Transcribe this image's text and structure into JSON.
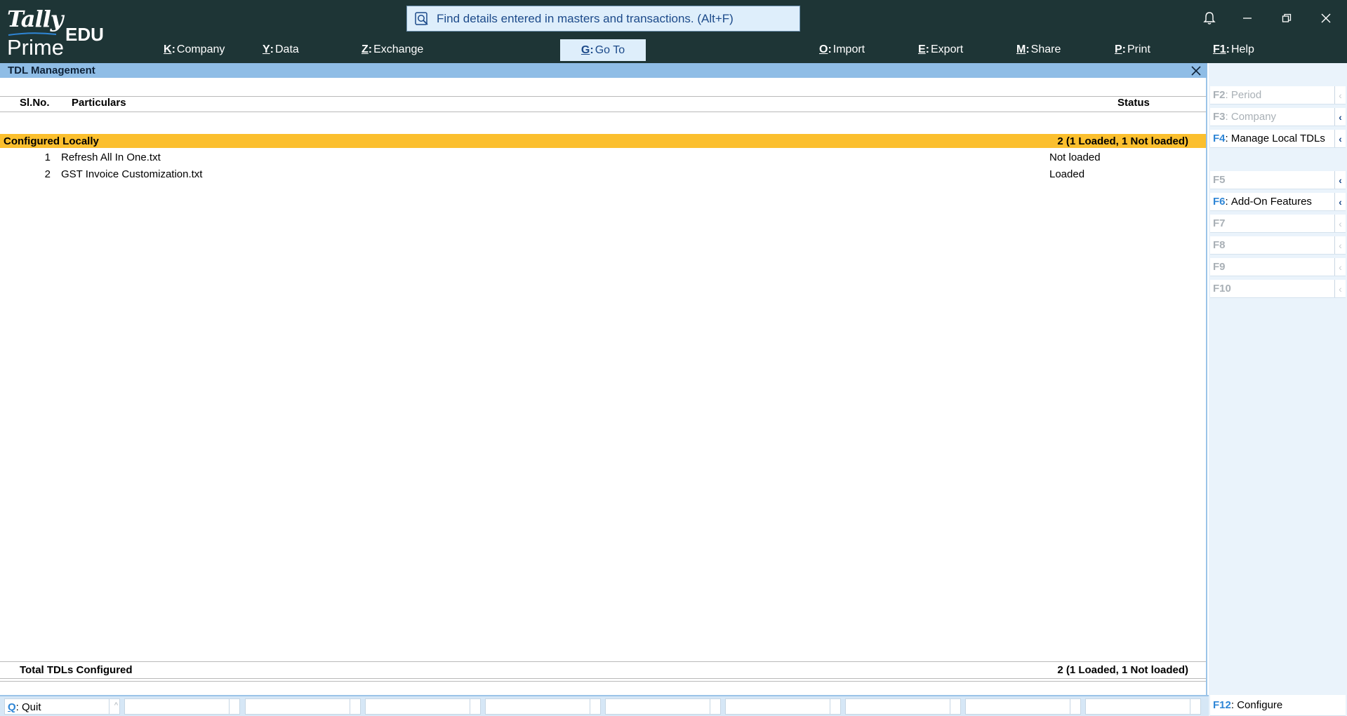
{
  "app": {
    "logo_tally": "Tally",
    "logo_prime": "Prime",
    "logo_edu": "EDU"
  },
  "search": {
    "placeholder": "Find details entered in masters and transactions. (Alt+F)"
  },
  "menu": [
    {
      "key": "K",
      "label": "Company"
    },
    {
      "key": "Y",
      "label": "Data"
    },
    {
      "key": "Z",
      "label": "Exchange"
    },
    {
      "key": "G",
      "label": "Go To"
    },
    {
      "key": "O",
      "label": "Import"
    },
    {
      "key": "E",
      "label": "Export"
    },
    {
      "key": "M",
      "label": "Share"
    },
    {
      "key": "P",
      "label": "Print"
    },
    {
      "key": "F1",
      "label": "Help"
    }
  ],
  "window_icons": [
    "bell-icon",
    "minimize-icon",
    "restore-icon",
    "close-icon"
  ],
  "screen": {
    "title": "TDL Management",
    "col_slno": "Sl.No.",
    "col_particulars": "Particulars",
    "col_status": "Status"
  },
  "group": {
    "label": "Configured Locally",
    "summary": "2 (1 Loaded, 1 Not loaded)"
  },
  "rows": [
    {
      "no": "1",
      "name": "Refresh All In One.txt",
      "status": "Not loaded"
    },
    {
      "no": "2",
      "name": "GST Invoice Customization.txt",
      "status": "Loaded"
    }
  ],
  "totals": {
    "label": "Total TDLs Configured",
    "value": "2 (1 Loaded, 1 Not loaded)"
  },
  "right_panel": [
    {
      "key": "F2",
      "label": "Period",
      "enabled": false
    },
    {
      "key": "F3",
      "label": "Company",
      "enabled": false
    },
    {
      "key": "F4",
      "label": "Manage Local TDLs",
      "enabled": true
    },
    {
      "key": "F5",
      "label": "",
      "enabled": false
    },
    {
      "key": "F6",
      "label": "Add-On Features",
      "enabled": true
    },
    {
      "key": "F7",
      "label": "",
      "enabled": false
    },
    {
      "key": "F8",
      "label": "",
      "enabled": false
    },
    {
      "key": "F9",
      "label": "",
      "enabled": false
    },
    {
      "key": "F10",
      "label": "",
      "enabled": false
    }
  ],
  "bottom": {
    "quit_key": "Q",
    "quit_label": "Quit",
    "configure_key": "F12",
    "configure_label": "Configure"
  },
  "colors": {
    "topbar": "#1e3536",
    "accent_blue": "#2f86d6",
    "title_bar": "#8fbde6",
    "group_highlight": "#fbbf2e"
  }
}
